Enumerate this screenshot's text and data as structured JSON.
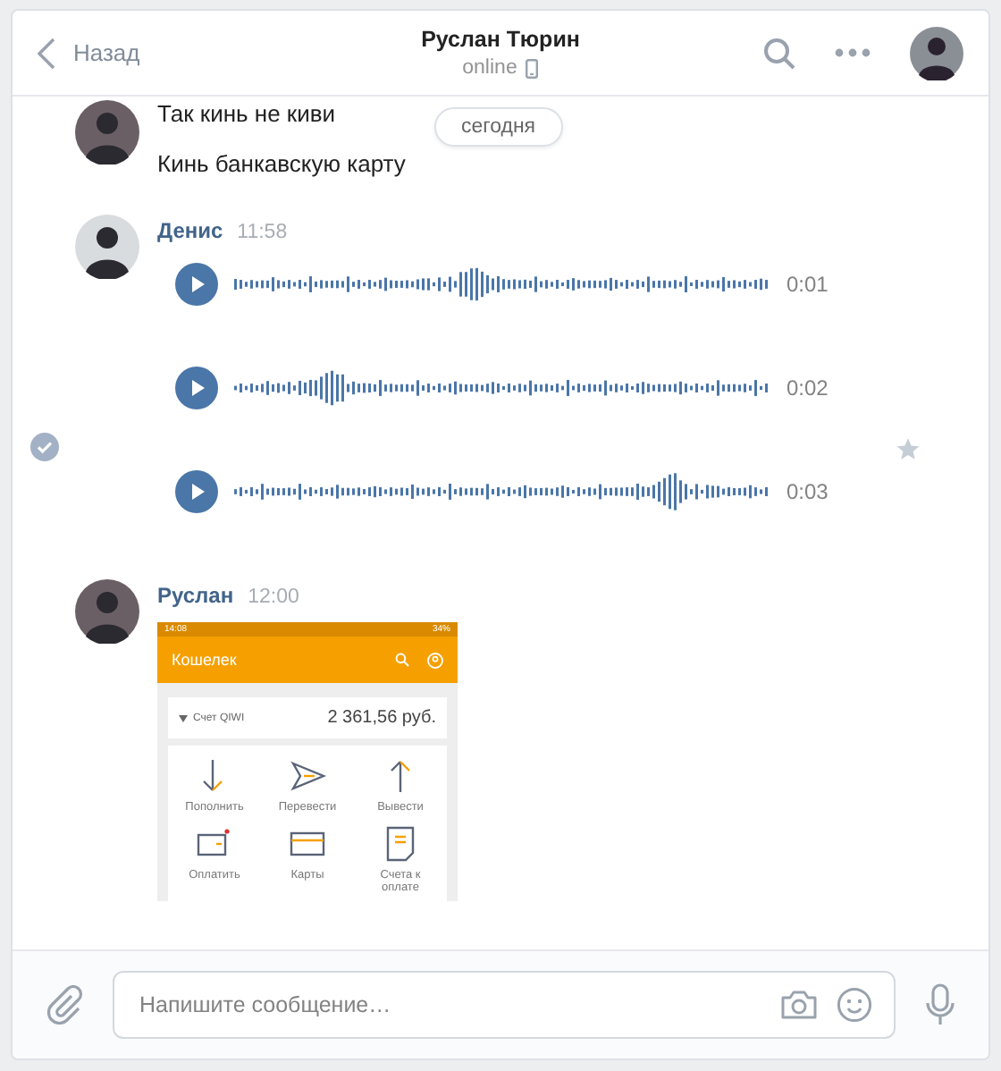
{
  "header": {
    "back_label": "Назад",
    "title": "Руслан Тюрин",
    "status": "online"
  },
  "date_badge": "сегодня",
  "messages": [
    {
      "selected": false,
      "items": [
        {
          "kind": "text",
          "text": "Так кинь не киви"
        },
        {
          "kind": "text",
          "text": "Кинь банкавскую карту"
        }
      ]
    },
    {
      "author": "Денис",
      "time": "11:58",
      "selected": true,
      "items": [
        {
          "kind": "voice",
          "duration": "0:01"
        },
        {
          "kind": "voice",
          "duration": "0:02"
        },
        {
          "kind": "voice",
          "duration": "0:03"
        }
      ]
    },
    {
      "author": "Руслан",
      "time": "12:00",
      "selected": false,
      "items": [
        {
          "kind": "screenshot",
          "status_time": "14:08",
          "battery": "34%",
          "title": "Кошелек",
          "account": "Счет QIWI",
          "balance": "2 361,56 руб.",
          "actions": [
            {
              "label": "Пополнить",
              "kind": "down"
            },
            {
              "label": "Перевести",
              "kind": "send"
            },
            {
              "label": "Вывести",
              "kind": "up"
            },
            {
              "label": "Оплатить",
              "kind": "pay"
            },
            {
              "label": "Карты",
              "kind": "card"
            },
            {
              "label": "Счета к оплате",
              "kind": "bill"
            }
          ]
        }
      ]
    }
  ],
  "composer": {
    "placeholder": "Напишите сообщение…"
  }
}
